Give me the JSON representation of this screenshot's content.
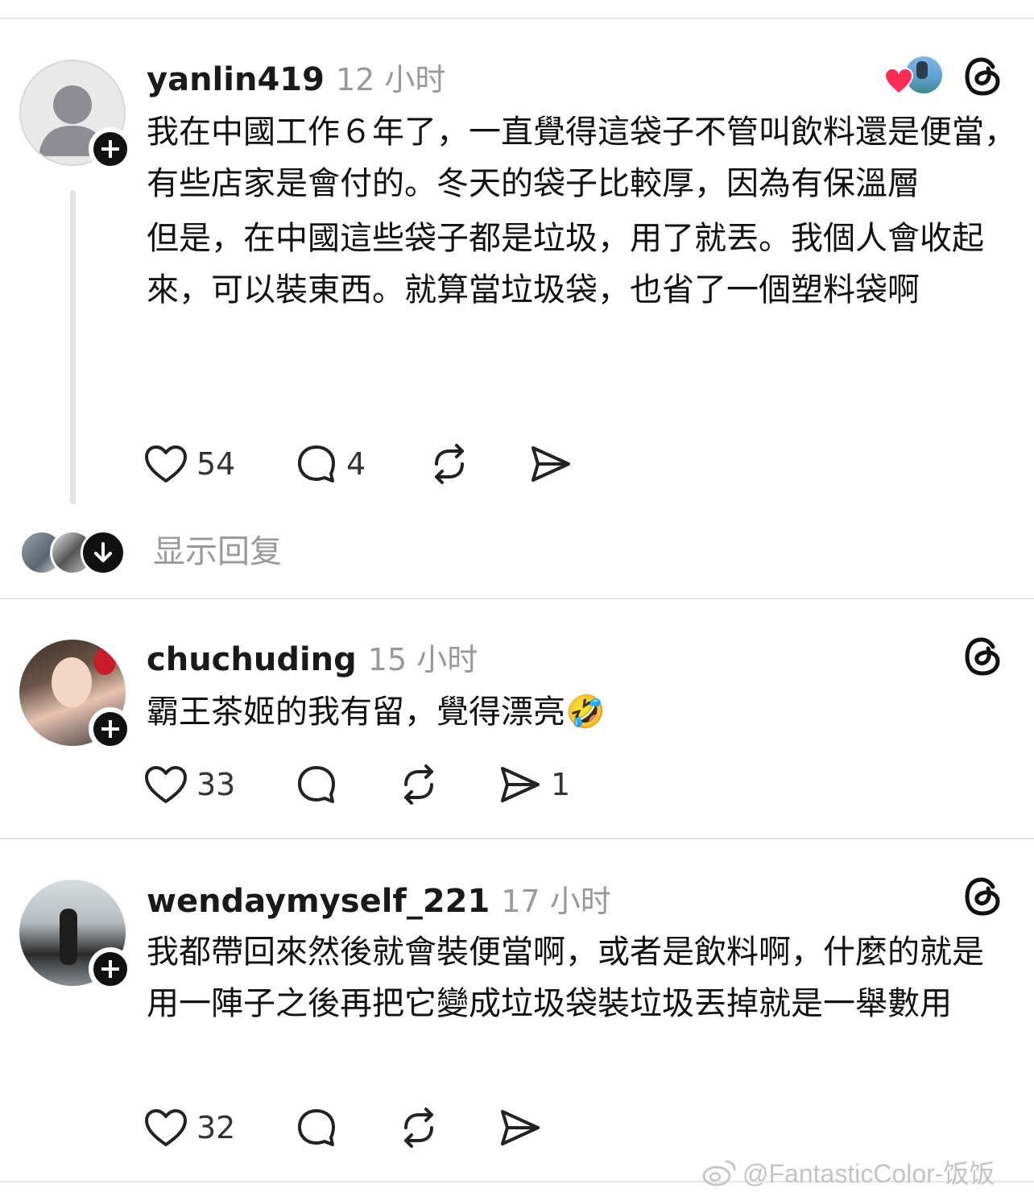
{
  "posts": [
    {
      "username": "yanlin419",
      "time": "12 小时",
      "paragraphs": [
        "我在中國工作６年了，一直覺得這袋子不管叫飲料還是便當，有些店家是會付的。冬天的袋子比較厚，因為有保溫層",
        "但是，在中國這些袋子都是垃圾，用了就丟。我個人會收起來，可以裝東西。就算當垃圾袋，也省了一個塑料袋啊"
      ],
      "likes": "54",
      "comments": "4",
      "reposts": "",
      "shares": ""
    },
    {
      "username": "chuchuding",
      "time": "15 小时",
      "paragraphs": [
        "霸王茶姬的我有留，覺得漂亮🤣"
      ],
      "likes": "33",
      "comments": "",
      "reposts": "",
      "shares": "1"
    },
    {
      "username": "wendaymyself_221",
      "time": "17 小时",
      "paragraphs": [
        "我都帶回來然後就會裝便當啊，或者是飲料啊，什麼的就是用一陣子之後再把它變成垃圾袋裝垃圾丟掉就是一舉數用"
      ],
      "likes": "32",
      "comments": "",
      "reposts": "",
      "shares": ""
    }
  ],
  "show_replies_label": "显示回复",
  "watermark": "@FantasticColor-饭饭",
  "colors": {
    "like_heart": "#ff2d55",
    "text": "#111111",
    "muted": "#999999",
    "divider": "#e6e6e6"
  }
}
